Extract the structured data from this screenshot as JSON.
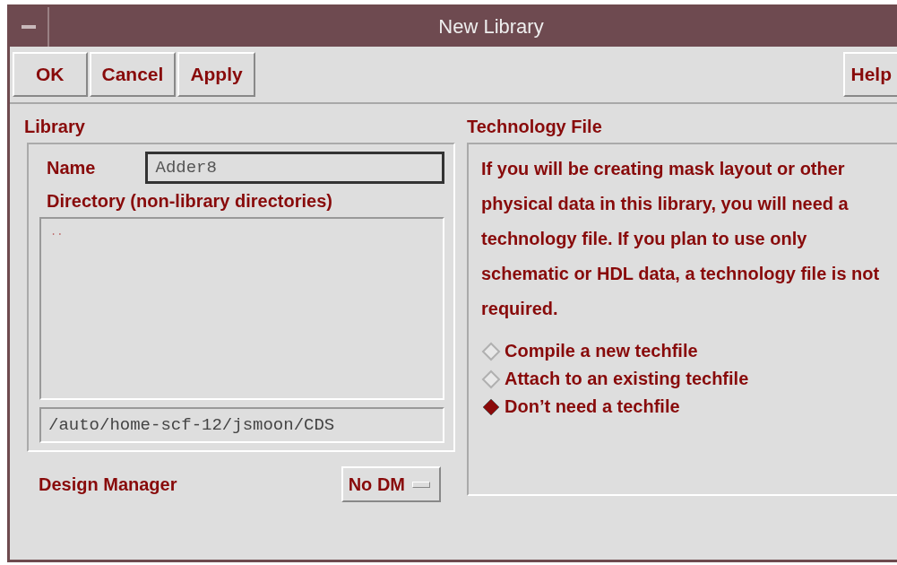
{
  "window": {
    "title": "New Library"
  },
  "buttons": [
    {
      "label": "OK"
    },
    {
      "label": "Cancel"
    },
    {
      "label": "Apply"
    }
  ],
  "help_button": {
    "label": "Help"
  },
  "library": {
    "heading": "Library",
    "name_label": "Name",
    "name_value": "Adder8",
    "directory_label": "Directory (non-library directories)",
    "directory_items": [
      ".."
    ],
    "path_value": "/auto/home-scf-12/jsmoon/CDS"
  },
  "technology_file": {
    "heading": "Technology File",
    "description": "If you will be creating mask layout or other physical data in this library, you will need a technology file. If you plan to use only schematic or HDL data, a technology file is not required.",
    "options": [
      {
        "label": "Compile a new techfile",
        "selected": false
      },
      {
        "label": "Attach to an existing techfile",
        "selected": false
      },
      {
        "label": "Don’t need a techfile",
        "selected": true
      }
    ]
  },
  "design_manager": {
    "label": "Design Manager",
    "value": "No DM"
  }
}
